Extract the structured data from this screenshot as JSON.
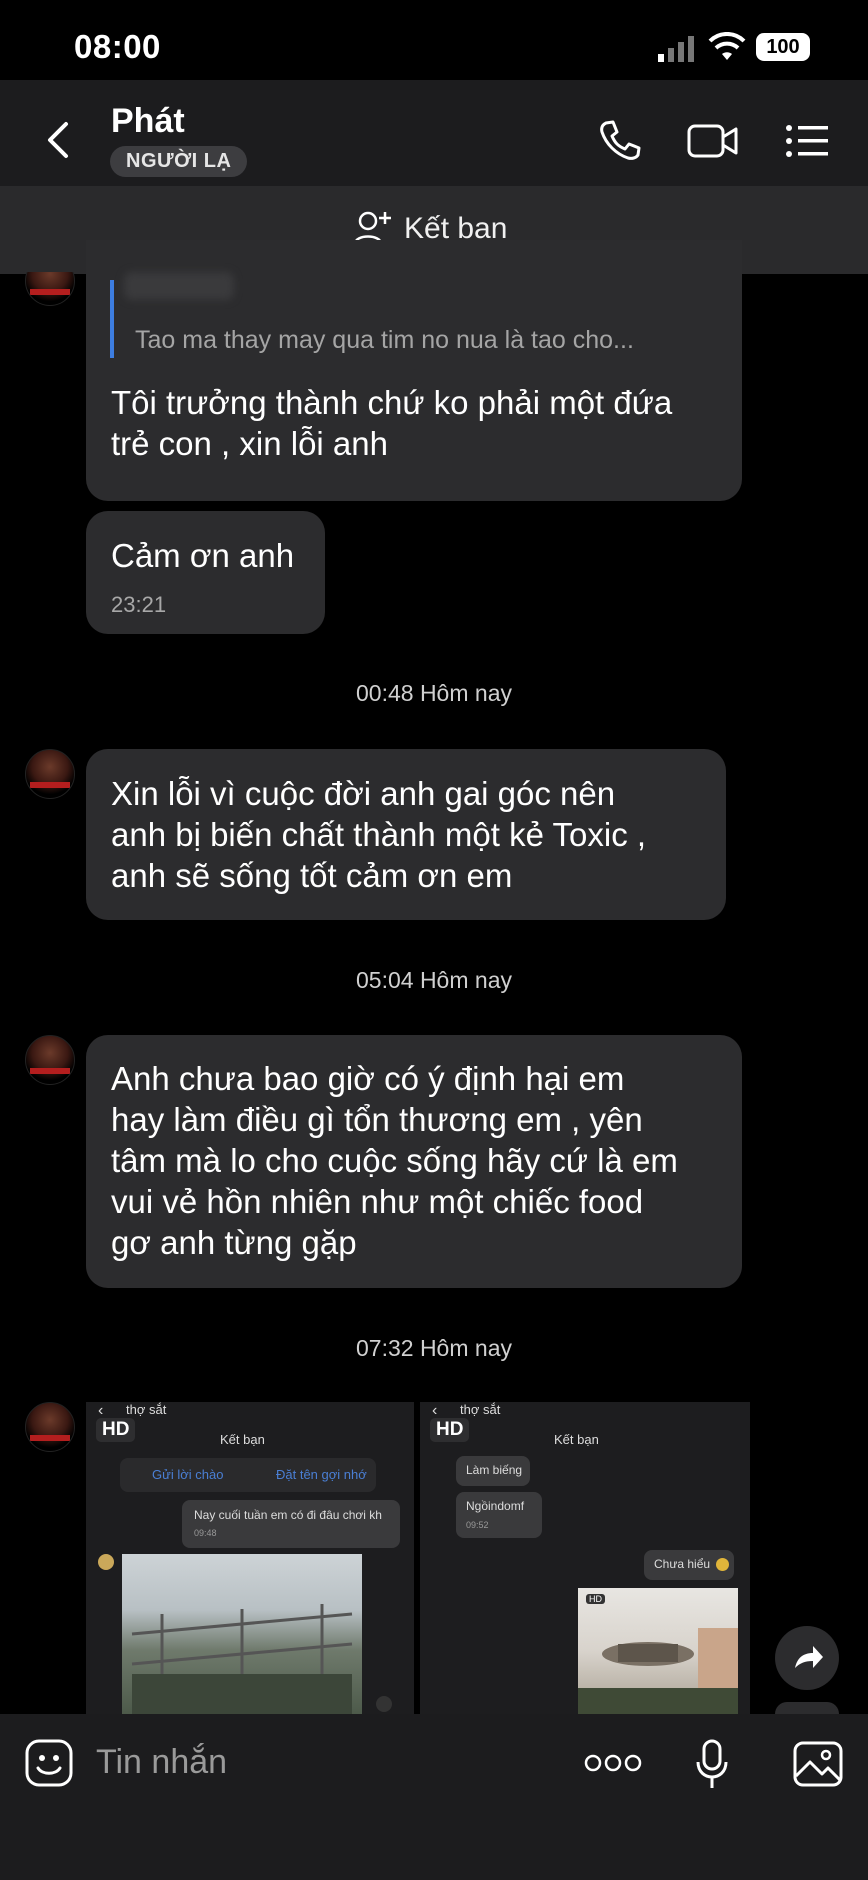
{
  "status": {
    "time": "08:00",
    "battery": "100"
  },
  "header": {
    "name": "Phát",
    "badge": "NGƯỜI LẠ"
  },
  "friend_bar": {
    "label": "Kết bạn"
  },
  "messages": {
    "quote_text": "Tao ma thay may qua tim no nua là tao cho...",
    "m1_line1": "Tôi trưởng thành chứ ko phải một đứa",
    "m1_line2": "trẻ con , xin lỗi anh",
    "m2_text": "Cảm ơn anh",
    "m2_time": "23:21",
    "div1": "00:48 Hôm nay",
    "m3_line1": "Xin lỗi vì cuộc đời anh gai góc nên",
    "m3_line2": "anh bị biến chất thành một kẻ Toxic ,",
    "m3_line3": "anh sẽ sống tốt cảm ơn em",
    "div2": "05:04 Hôm nay",
    "m4_line1": "Anh chưa bao giờ có ý định hại em",
    "m4_line2": "hay làm điều gì tổn thương em , yên",
    "m4_line3": "tâm mà lo cho cuộc sống hãy cứ là em",
    "m4_line4": "vui vẻ hồn nhiên như một chiếc food",
    "m4_line5": "gơ anh từng gặp",
    "div3": "07:32 Hôm nay"
  },
  "shot1": {
    "hd": "HD",
    "search": "thợ sắt",
    "add_friend": "Kết bạn",
    "greet": "Gửi lời chào",
    "nickname": "Đặt tên gợi nhớ",
    "msg": "Nay cuối tuần em có đi đâu chơi kh",
    "msg_time": "09:48"
  },
  "shot2": {
    "hd": "HD",
    "search": "thợ sắt",
    "add_friend": "Kết bạn",
    "msg1": "Làm biếng",
    "msg2": "Ngồindomf",
    "msg2_time": "09:52",
    "reply": "Chưa hiểu",
    "hd_small": "HD"
  },
  "composer": {
    "placeholder": "Tin nhắn"
  }
}
